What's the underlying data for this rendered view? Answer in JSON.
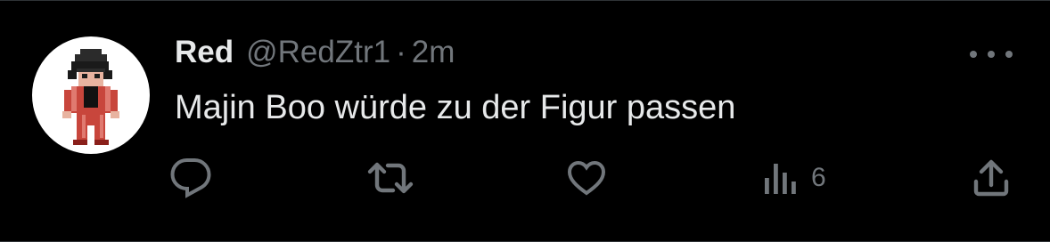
{
  "tweet": {
    "display_name": "Red",
    "handle": "@RedZtr1",
    "separator": "·",
    "time": "2m",
    "text": "Majin Boo würde zu der Figur passen",
    "actions": {
      "reply_icon": "reply-icon",
      "retweet_icon": "retweet-icon",
      "like_icon": "heart-icon",
      "views_icon": "views-icon",
      "views_count": "6",
      "share_icon": "share-icon"
    },
    "more_icon": "more-dots-icon"
  },
  "colors": {
    "background": "#000000",
    "primary_text": "#e7e9ea",
    "secondary_text": "#71767b",
    "avatar_background": "#ffffff"
  }
}
